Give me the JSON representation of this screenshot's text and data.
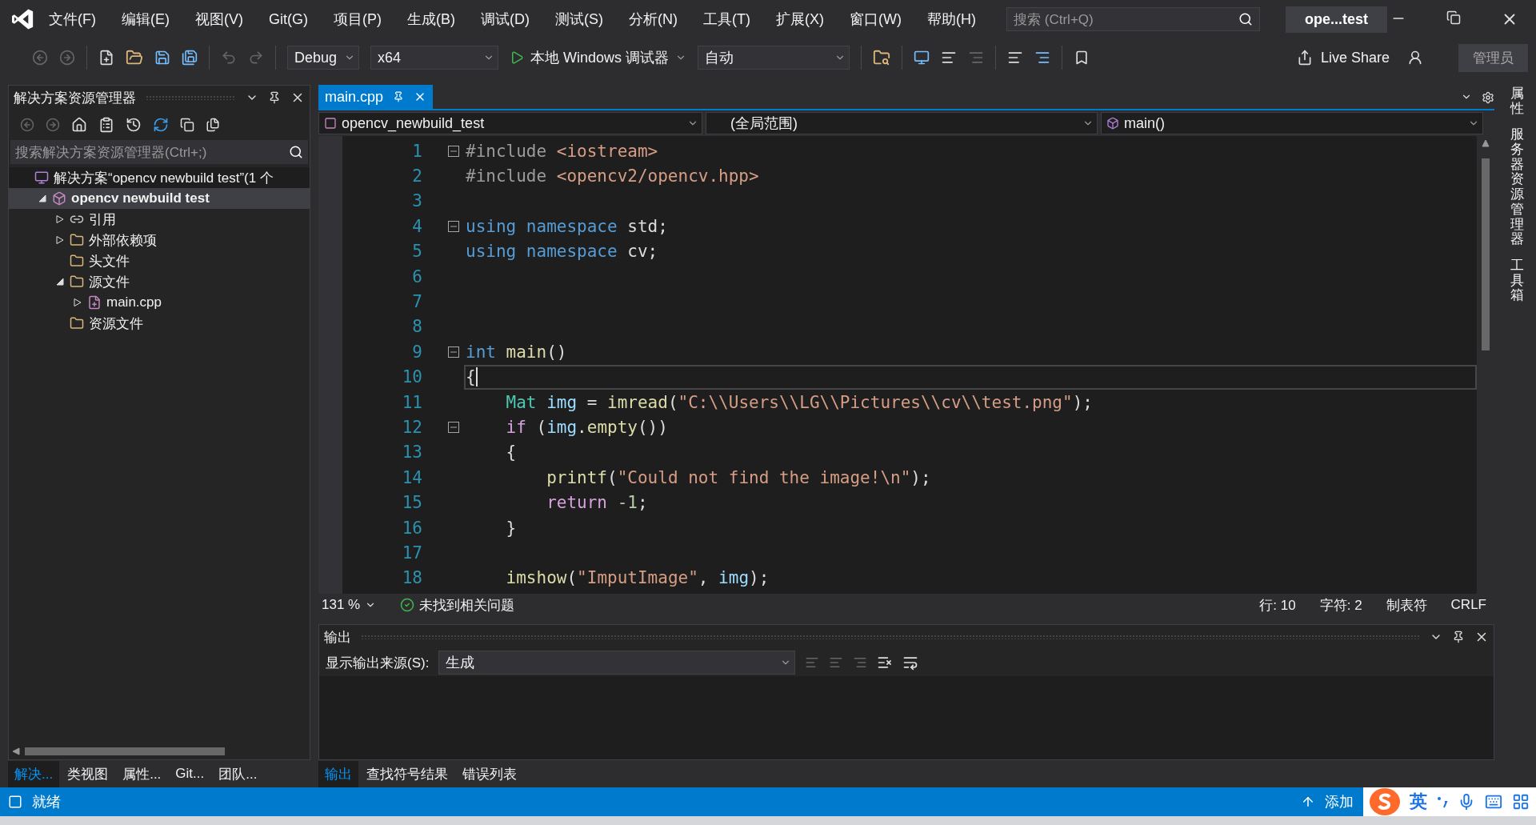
{
  "title_bar": {
    "menu": [
      "文件(F)",
      "编辑(E)",
      "视图(V)",
      "Git(G)",
      "项目(P)",
      "生成(B)",
      "调试(D)",
      "测试(S)",
      "分析(N)",
      "工具(T)",
      "扩展(X)",
      "窗口(W)",
      "帮助(H)"
    ],
    "search": {
      "placeholder": "搜索 (Ctrl+Q)"
    },
    "title": "ope...test"
  },
  "toolbar": {
    "configuration": "Debug",
    "platform": "x64",
    "debugger": "本地 Windows 调试器",
    "target": "自动",
    "live_share": "Live Share",
    "account": "管理员"
  },
  "solution_explorer": {
    "title": "解决方案资源管理器",
    "search": {
      "placeholder": "搜索解决方案资源管理器(Ctrl+;)"
    },
    "tree": [
      {
        "label": "解决方案“opencv newbuild test”(1 个",
        "kind": "solution",
        "selected": false,
        "children": [
          {
            "label": "opencv newbuild test",
            "kind": "project",
            "selected": true,
            "expanded": true,
            "children": [
              {
                "label": "引用",
                "kind": "references",
                "selected": false,
                "expanded": false
              },
              {
                "label": "外部依赖项",
                "kind": "external",
                "selected": false,
                "expanded": false
              },
              {
                "label": "头文件",
                "kind": "filter",
                "selected": false
              },
              {
                "label": "源文件",
                "kind": "filter",
                "selected": false,
                "expanded": true,
                "children": [
                  {
                    "label": "main.cpp",
                    "kind": "cpp",
                    "selected": false,
                    "expanded": false
                  }
                ]
              },
              {
                "label": "资源文件",
                "kind": "filter",
                "selected": false
              }
            ]
          }
        ]
      }
    ],
    "tabs": [
      {
        "label": "解决...",
        "selected": true
      },
      {
        "label": "类视图",
        "selected": false
      },
      {
        "label": "属性...",
        "selected": false
      },
      {
        "label": "Git...",
        "selected": false
      },
      {
        "label": "团队...",
        "selected": false
      }
    ]
  },
  "editor": {
    "tabs": [
      {
        "label": "main.cpp",
        "selected": true
      }
    ],
    "nav": [
      "opencv_newbuild_test",
      "(全局范围)",
      "main()"
    ],
    "lines": [
      {
        "number": "1",
        "fold": true,
        "current": false,
        "tokens": [
          {
            "text": "#include",
            "kind": "preproc"
          },
          {
            "text": " <iostream>",
            "kind": "string"
          }
        ]
      },
      {
        "number": "2",
        "fold": false,
        "current": false,
        "tokens": [
          {
            "text": "#include",
            "kind": "preproc"
          },
          {
            "text": " <opencv2/opencv.hpp>",
            "kind": "string"
          }
        ]
      },
      {
        "number": "3",
        "fold": false,
        "current": false
      },
      {
        "number": "4",
        "fold": true,
        "current": false,
        "tokens": [
          {
            "text": "using namespace",
            "kind": "keyword"
          },
          {
            "text": " std;",
            "kind": "plain"
          }
        ]
      },
      {
        "number": "5",
        "fold": false,
        "current": false,
        "tokens": [
          {
            "text": "using namespace",
            "kind": "keyword"
          },
          {
            "text": " cv;",
            "kind": "plain"
          }
        ]
      },
      {
        "number": "6",
        "fold": false,
        "current": false
      },
      {
        "number": "7",
        "fold": false,
        "current": false
      },
      {
        "number": "8",
        "fold": false,
        "current": false
      },
      {
        "number": "9",
        "fold": true,
        "current": false,
        "tokens": [
          {
            "text": "int",
            "kind": "keyword"
          },
          {
            "text": " main",
            "kind": "func"
          },
          {
            "text": "()",
            "kind": "plain"
          }
        ]
      },
      {
        "number": "10",
        "fold": false,
        "current": true,
        "tokens": [
          {
            "text": "{",
            "kind": "plain"
          }
        ]
      },
      {
        "number": "11",
        "fold": false,
        "current": false,
        "tokens": [
          {
            "text": "    Mat",
            "kind": "type"
          },
          {
            "text": " img",
            "kind": "var"
          },
          {
            "text": " = ",
            "kind": "plain"
          },
          {
            "text": "imread",
            "kind": "func"
          },
          {
            "text": "(",
            "kind": "plain"
          },
          {
            "text": "\"C:\\\\Users\\\\LG\\\\Pictures\\\\cv\\\\test.png\"",
            "kind": "string"
          },
          {
            "text": ");",
            "kind": "plain"
          }
        ]
      },
      {
        "number": "12",
        "fold": true,
        "current": false,
        "tokens": [
          {
            "text": "    if",
            "kind": "control"
          },
          {
            "text": " (",
            "kind": "plain"
          },
          {
            "text": "img",
            "kind": "var"
          },
          {
            "text": ".",
            "kind": "plain"
          },
          {
            "text": "empty",
            "kind": "func"
          },
          {
            "text": "())",
            "kind": "plain"
          }
        ]
      },
      {
        "number": "13",
        "fold": false,
        "current": false,
        "tokens": [
          {
            "text": "    {",
            "kind": "plain"
          }
        ]
      },
      {
        "number": "14",
        "fold": false,
        "current": false,
        "tokens": [
          {
            "text": "        printf",
            "kind": "func"
          },
          {
            "text": "(",
            "kind": "plain"
          },
          {
            "text": "\"Could not find the image!\\n\"",
            "kind": "string"
          },
          {
            "text": ");",
            "kind": "plain"
          }
        ]
      },
      {
        "number": "15",
        "fold": false,
        "current": false,
        "tokens": [
          {
            "text": "        return",
            "kind": "control"
          },
          {
            "text": " -1",
            "kind": "number"
          },
          {
            "text": ";",
            "kind": "plain"
          }
        ]
      },
      {
        "number": "16",
        "fold": false,
        "current": false,
        "tokens": [
          {
            "text": "    }",
            "kind": "plain"
          }
        ]
      },
      {
        "number": "17",
        "fold": false,
        "current": false
      },
      {
        "number": "18",
        "fold": false,
        "current": false,
        "tokens": [
          {
            "text": "    imshow",
            "kind": "func"
          },
          {
            "text": "(",
            "kind": "plain"
          },
          {
            "text": "\"ImputImage\"",
            "kind": "string"
          },
          {
            "text": ", ",
            "kind": "plain"
          },
          {
            "text": "img",
            "kind": "var"
          },
          {
            "text": ");",
            "kind": "plain"
          }
        ]
      }
    ],
    "status": {
      "zoom": "131 %",
      "issues": "未找到相关问题",
      "line": "行: 10",
      "column": "字符: 2",
      "indent": "制表符",
      "eol": "CRLF"
    }
  },
  "output": {
    "title": "输出",
    "source_label": "显示输出来源(S):",
    "source": "生成",
    "tabs": [
      {
        "label": "输出",
        "selected": true
      },
      {
        "label": "查找符号结果",
        "selected": false
      },
      {
        "label": "错误列表",
        "selected": false
      }
    ]
  },
  "side_tabs": [
    "属性",
    "服务器资源管理器",
    "工具箱"
  ],
  "status_bar": {
    "state": "就绪",
    "publish": "添加"
  },
  "ime": {
    "mode": "英"
  }
}
